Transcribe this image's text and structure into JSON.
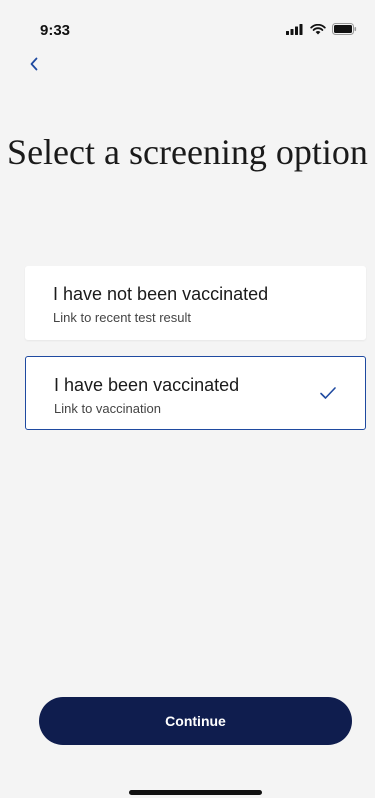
{
  "status_bar": {
    "time": "9:33",
    "icons": [
      "signal-icon",
      "wifi-icon",
      "battery-icon"
    ]
  },
  "header": {
    "back_icon": "chevron-left-icon",
    "title": "Select a screening option"
  },
  "options": [
    {
      "title": "I have not been vaccinated",
      "subtitle": "Link to recent test result",
      "selected": false
    },
    {
      "title": "I have been vaccinated",
      "subtitle": "Link to vaccination",
      "selected": true,
      "check_icon": "checkmark-icon"
    }
  ],
  "footer": {
    "continue_label": "Continue"
  },
  "colors": {
    "primary_button": "#0f1d4e",
    "selected_border": "#1f4aa0",
    "background": "#f4f4f4"
  }
}
